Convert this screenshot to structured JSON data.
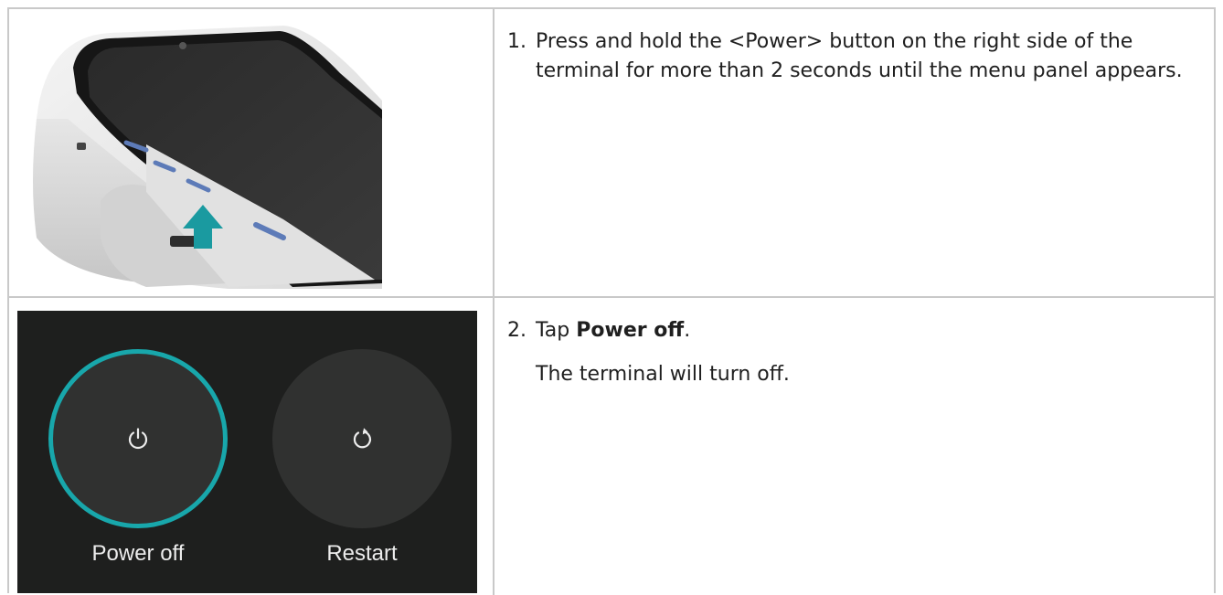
{
  "steps": [
    {
      "number": "1.",
      "text": "Press and hold the <Power> button on the right side of the terminal for more than 2 seconds until the menu panel appears."
    },
    {
      "number": "2.",
      "text_before": "Tap ",
      "text_bold": "Power off",
      "text_after": ".",
      "note": "The terminal will turn off."
    }
  ],
  "power_menu": {
    "power_off_label": "Power off",
    "restart_label": "Restart",
    "power_icon": "power-icon",
    "restart_icon": "restart-icon"
  },
  "colors": {
    "accent": "#18a7ab",
    "menu_bg": "#1e1f1e",
    "button_bg": "#303130",
    "border": "#c9c9c9"
  }
}
